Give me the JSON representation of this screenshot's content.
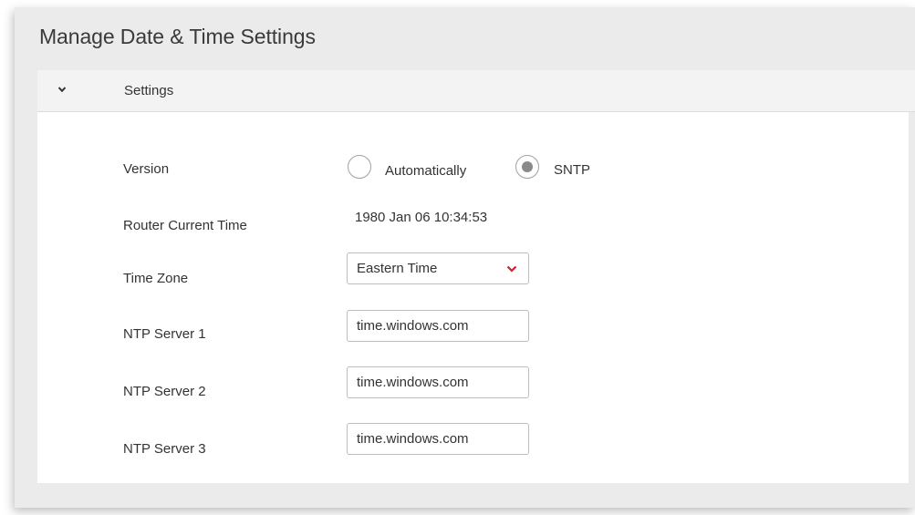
{
  "page": {
    "title": "Manage Date & Time Settings"
  },
  "panel": {
    "header_label": "Settings",
    "expanded": true
  },
  "version": {
    "label": "Version",
    "options": [
      {
        "label": "Automatically",
        "selected": false
      },
      {
        "label": "SNTP",
        "selected": true
      }
    ]
  },
  "router_time": {
    "label": "Router Current Time",
    "value": "1980 Jan 06 10:34:53"
  },
  "time_zone": {
    "label": "Time Zone",
    "selected": "Eastern Time"
  },
  "ntp_servers": [
    {
      "label": "NTP Server 1",
      "value": "time.windows.com"
    },
    {
      "label": "NTP Server 2",
      "value": "time.windows.com"
    },
    {
      "label": "NTP Server 3",
      "value": "time.windows.com"
    }
  ],
  "colors": {
    "accent": "#d0202e",
    "frame_bg": "#ebebeb",
    "panel_header_bg": "#f3f3f3"
  }
}
